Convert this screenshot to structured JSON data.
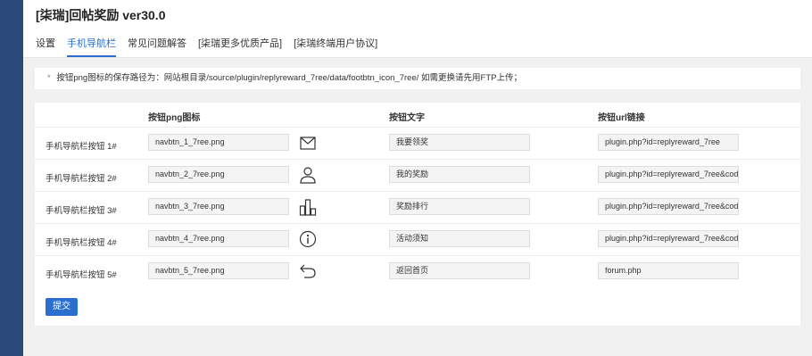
{
  "app": {
    "title": "[柒瑞]回帖奖励 ver30.0"
  },
  "tabs": [
    {
      "label": "设置",
      "active": false
    },
    {
      "label": "手机导航栏",
      "active": true
    },
    {
      "label": "常见问题解答",
      "active": false
    },
    {
      "label": "[柒瑞更多优质产品]",
      "active": false
    },
    {
      "label": "[柒瑞终端用户协议]",
      "active": false
    }
  ],
  "notice": {
    "bullet": "*",
    "text": "按钮png图标的保存路径为：网站根目录/source/plugin/replyreward_7ree/data/footbtn_icon_7ree/ 如需更换请先用FTP上传；"
  },
  "table": {
    "headers": {
      "icon": "按钮png图标",
      "text": "按钮文字",
      "url": "按钮url链接"
    },
    "rows": [
      {
        "label": "手机导航栏按钮 1#",
        "png": "navbtn_1_7ree.png",
        "icon": "envelope-icon",
        "text": "我要领奖",
        "url": "plugin.php?id=replyreward_7ree"
      },
      {
        "label": "手机导航栏按钮 2#",
        "png": "navbtn_2_7ree.png",
        "icon": "user-icon",
        "text": "我的奖励",
        "url": "plugin.php?id=replyreward_7ree&cod"
      },
      {
        "label": "手机导航栏按钮 3#",
        "png": "navbtn_3_7ree.png",
        "icon": "bar-chart-icon",
        "text": "奖励排行",
        "url": "plugin.php?id=replyreward_7ree&cod"
      },
      {
        "label": "手机导航栏按钮 4#",
        "png": "navbtn_4_7ree.png",
        "icon": "info-icon",
        "text": "活动须知",
        "url": "plugin.php?id=replyreward_7ree&cod"
      },
      {
        "label": "手机导航栏按钮 5#",
        "png": "navbtn_5_7ree.png",
        "icon": "return-icon",
        "text": "返回首页",
        "url": "forum.php"
      }
    ]
  },
  "submit": {
    "label": "提交"
  },
  "colors": {
    "accent": "#2a6fce",
    "sidebar": "#2a4a7b"
  }
}
